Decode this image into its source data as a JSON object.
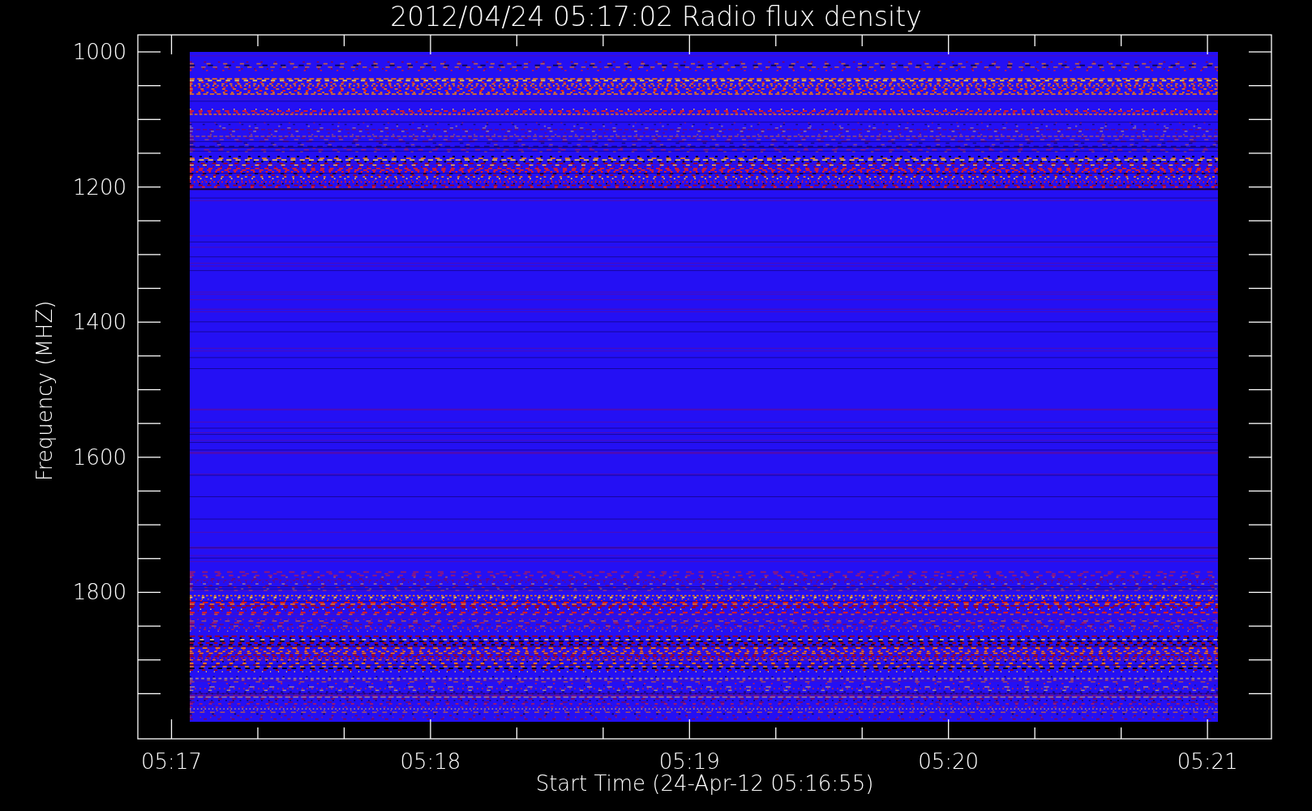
{
  "plot": {
    "title": "2012/04/24 05:17:02 Radio flux density",
    "ylabel": "Frequency (MHZ)",
    "xlabel": "Start Time (24-Apr-12 05:16:55)",
    "yticks": [
      "1000",
      "1200",
      "1400",
      "1600",
      "1800"
    ],
    "xticks": [
      "05:17",
      "05:18",
      "05:19",
      "05:20",
      "05:21"
    ]
  }
}
